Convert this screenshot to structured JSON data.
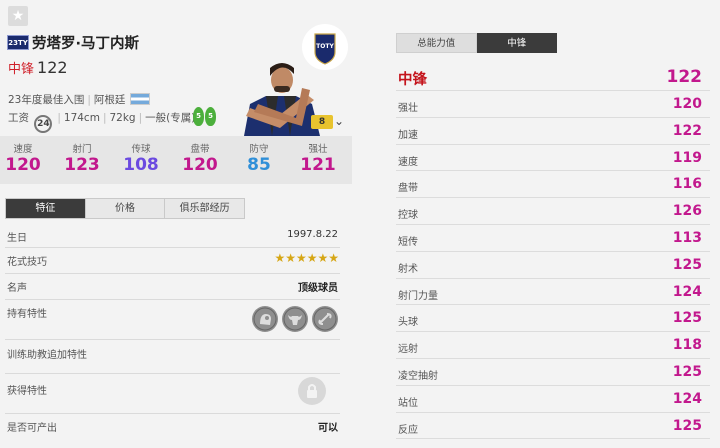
{
  "header": {
    "favorite_icon": "star-icon",
    "season_badge": "23TY",
    "player_name": "劳塔罗·马丁内斯",
    "position": "中锋",
    "overall": "122",
    "season_label": "23年度最佳入围",
    "nationality": "阿根廷",
    "wage_label": "工资",
    "wage": "24",
    "height": "174cm",
    "weight": "72kg",
    "body_type": "一般(专属)",
    "left_foot": "5",
    "right_foot": "5",
    "grade": "8",
    "team_logo_text": "TOTY"
  },
  "summary_stats": [
    {
      "label": "速度",
      "value": "120",
      "color": "#c2188d"
    },
    {
      "label": "射门",
      "value": "123",
      "color": "#c2188d"
    },
    {
      "label": "传球",
      "value": "108",
      "color": "#6b4ae0"
    },
    {
      "label": "盘带",
      "value": "120",
      "color": "#c2188d"
    },
    {
      "label": "防守",
      "value": "85",
      "color": "#2f8fd8"
    },
    {
      "label": "强壮",
      "value": "121",
      "color": "#c2188d"
    }
  ],
  "left_tabs": [
    "特征",
    "价格",
    "俱乐部经历"
  ],
  "info": {
    "birthday_label": "生日",
    "birthday": "1997.8.22",
    "skill_label": "花式技巧",
    "skill_stars": "★★★★★★",
    "reputation_label": "名声",
    "reputation": "顶级球员",
    "traits_label": "持有特性",
    "trait_icons": [
      "trait-head-icon",
      "trait-bull-icon",
      "trait-chain-icon"
    ],
    "training_label": "训练助教追加特性",
    "acquired_label": "获得特性",
    "lock_icon": "lock-icon",
    "producible_label": "是否可产出",
    "producible": "可以"
  },
  "right_tabs": [
    "总能力值",
    "中锋"
  ],
  "attributes": [
    {
      "name": "中锋",
      "value": "122",
      "color": "#c2188d"
    },
    {
      "name": "强壮",
      "value": "120",
      "color": "#c2188d"
    },
    {
      "name": "加速",
      "value": "122",
      "color": "#c2188d"
    },
    {
      "name": "速度",
      "value": "119",
      "color": "#c2188d"
    },
    {
      "name": "盘带",
      "value": "116",
      "color": "#c2188d"
    },
    {
      "name": "控球",
      "value": "126",
      "color": "#c2188d"
    },
    {
      "name": "短传",
      "value": "113",
      "color": "#c2188d"
    },
    {
      "name": "射术",
      "value": "125",
      "color": "#c2188d"
    },
    {
      "name": "射门力量",
      "value": "124",
      "color": "#c2188d"
    },
    {
      "name": "头球",
      "value": "125",
      "color": "#c2188d"
    },
    {
      "name": "远射",
      "value": "118",
      "color": "#c2188d"
    },
    {
      "name": "凌空抽射",
      "value": "125",
      "color": "#c2188d"
    },
    {
      "name": "站位",
      "value": "124",
      "color": "#c2188d"
    },
    {
      "name": "反应",
      "value": "125",
      "color": "#c2188d"
    }
  ]
}
